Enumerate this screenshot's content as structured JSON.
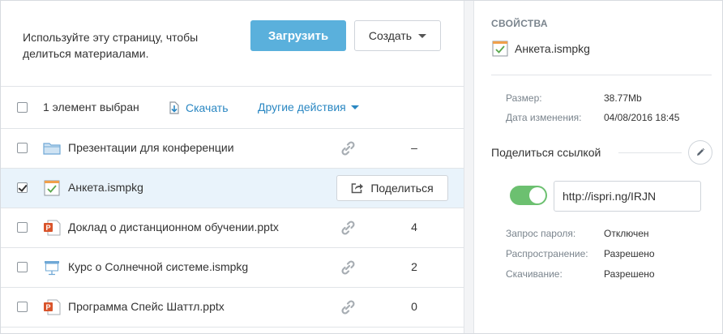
{
  "header": {
    "intro_text": "Используйте эту страницу, чтобы делиться материалами.",
    "upload_label": "Загрузить",
    "create_label": "Создать"
  },
  "toolbar": {
    "selected_text": "1 элемент выбран",
    "download_label": "Скачать",
    "more_actions_label": "Другие действия"
  },
  "files": [
    {
      "name": "Презентации для конференции",
      "type": "folder",
      "count": "–",
      "checked": false
    },
    {
      "name": "Анкета.ismpkg",
      "type": "quiz",
      "count": "",
      "checked": true,
      "share_label": "Поделиться"
    },
    {
      "name": "Доклад о дистанционном обучении.pptx",
      "type": "pptx",
      "count": "4",
      "checked": false
    },
    {
      "name": "Курс о Солнечной системе.ismpkg",
      "type": "course",
      "count": "2",
      "checked": false
    },
    {
      "name": "Программа Спейс Шаттл.pptx",
      "type": "pptx",
      "count": "0",
      "checked": false
    }
  ],
  "properties": {
    "title": "СВОЙСТВА",
    "file_name": "Анкета.ismpkg",
    "size_label": "Размер:",
    "size_value": "38.77Mb",
    "modified_label": "Дата изменения:",
    "modified_value": "04/08/2016 18:45",
    "share_link_title": "Поделиться ссылкой",
    "link_enabled": true,
    "share_url": "http://ispri.ng/IRJN",
    "password_label": "Запрос пароля:",
    "password_value": "Отключен",
    "distribution_label": "Распространение:",
    "distribution_value": "Разрешено",
    "download_label": "Скачивание:",
    "download_value": "Разрешено"
  },
  "colors": {
    "accent": "#5ab0dc",
    "link": "#2a87c2",
    "toggle_on": "#6cc070",
    "selected_row": "#e9f3fb"
  }
}
